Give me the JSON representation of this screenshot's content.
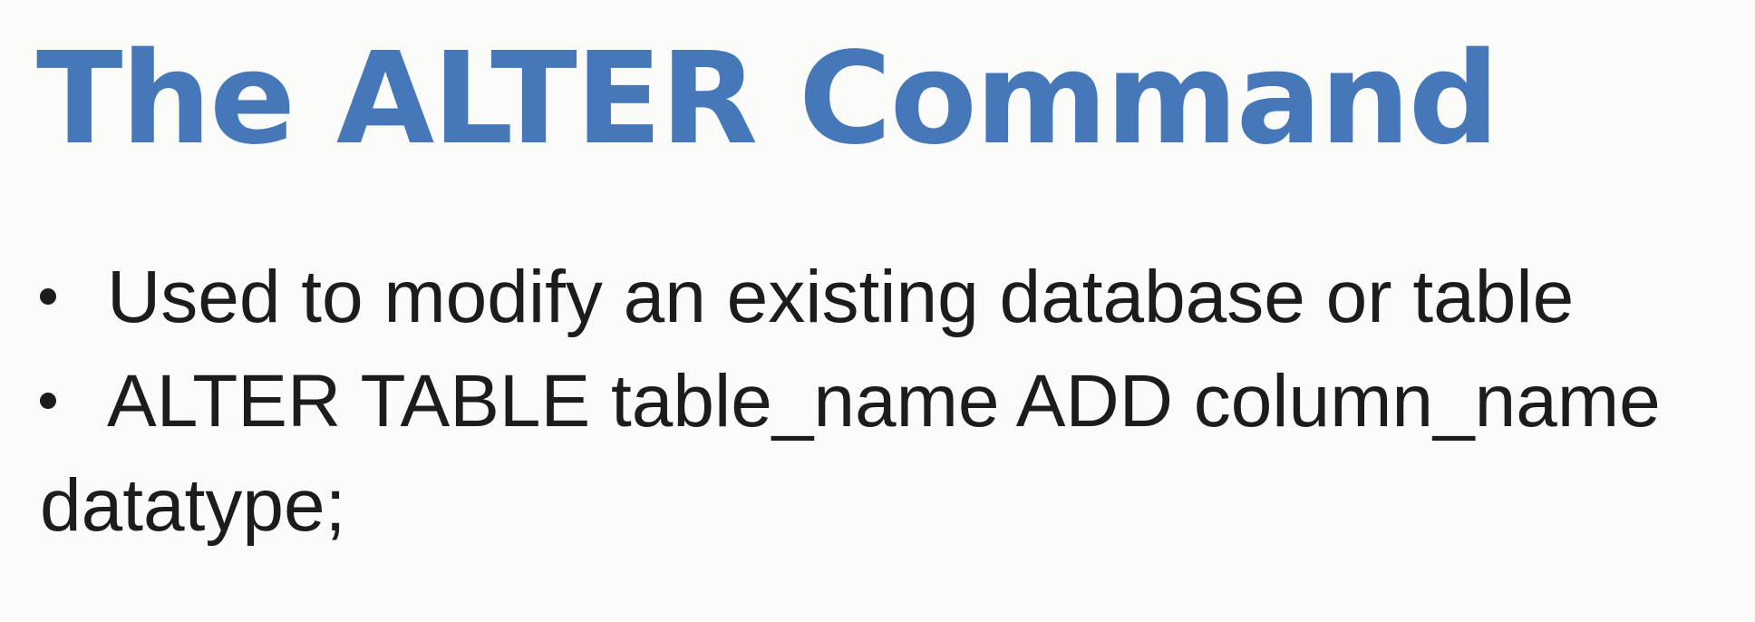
{
  "slide": {
    "title": "The ALTER Command",
    "title_color": "#4678b9",
    "text_color": "#1c1c1c",
    "background": "#fbfbfa",
    "bullets": [
      "Used to modify an existing database or table",
      "ALTER TABLE table_name ADD column_name datatype;"
    ]
  }
}
